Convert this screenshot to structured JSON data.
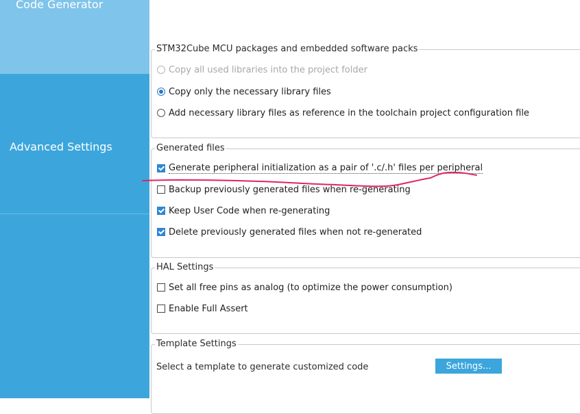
{
  "sidebar": {
    "items": [
      {
        "label": "Code Generator"
      },
      {
        "label": "Advanced Settings"
      }
    ]
  },
  "packages": {
    "legend": "STM32Cube MCU packages and embedded software packs",
    "options": [
      {
        "label": "Copy all used libraries into the project folder",
        "selected": false,
        "disabled": true
      },
      {
        "label": "Copy only the necessary library files",
        "selected": true,
        "disabled": false
      },
      {
        "label": "Add necessary library files as reference in the toolchain project configuration file",
        "selected": false,
        "disabled": false
      }
    ]
  },
  "generated_files": {
    "legend": "Generated files",
    "options": [
      {
        "label": "Generate peripheral initialization as a pair of '.c/.h' files per peripheral",
        "checked": true
      },
      {
        "label": "Backup previously generated files when re-generating",
        "checked": false
      },
      {
        "label": "Keep User Code when re-generating",
        "checked": true
      },
      {
        "label": "Delete previously generated files when not re-generated",
        "checked": true
      }
    ]
  },
  "hal": {
    "legend": "HAL Settings",
    "options": [
      {
        "label": "Set all free pins as analog (to optimize the power consumption)",
        "checked": false
      },
      {
        "label": "Enable Full Assert",
        "checked": false
      }
    ]
  },
  "template": {
    "legend": "Template Settings",
    "description": "Select a template to generate customized code",
    "button_label": "Settings..."
  },
  "colors": {
    "sidebar": "#3ca6dc",
    "sidebar_inactive": "#7fc4ea",
    "accent": "#2c87d4",
    "annotation": "#e0245e"
  }
}
